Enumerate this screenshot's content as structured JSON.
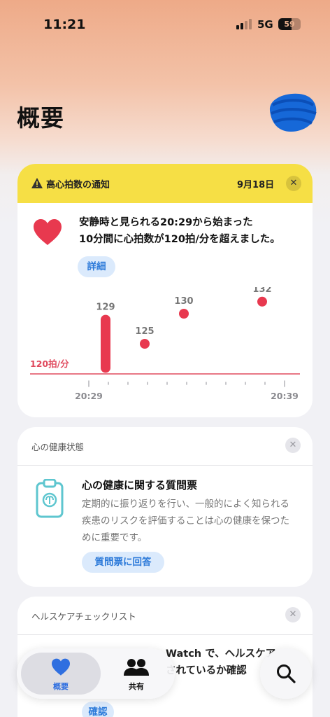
{
  "status_bar": {
    "time": "11:21",
    "network": "5G",
    "battery": "59"
  },
  "page": {
    "title": "概要"
  },
  "heart_alert": {
    "title": "高心拍数の通知",
    "date": "9月18日",
    "message_line1": "安静時と見られる20:29から始まった",
    "message_line2": "10分間に心拍数が120拍/分を超えました。",
    "details_label": "詳細",
    "threshold_label": "120拍/分",
    "start_label": "20:29",
    "end_label": "20:39",
    "readings": [
      {
        "label": "129",
        "min": 121,
        "max": 129
      },
      {
        "label": "125",
        "min": 125,
        "max": 125
      },
      {
        "label": "130",
        "min": 130,
        "max": 130
      },
      {
        "label": "132",
        "min": 132,
        "max": 132
      }
    ],
    "colors": {
      "header": "#f6df45",
      "heart": "#e8394f",
      "threshold": "#e04a5e"
    }
  },
  "mental_health": {
    "section": "心の健康状態",
    "title": "心の健康に関する質問票",
    "body": "定期的に振り返りを行い、一般的によく知られる疾患のリスクを評価することは心の健康を保つために重要です。",
    "button": "質問票に回答"
  },
  "checklist": {
    "section": "ヘルスケアチェックリスト",
    "line1": "Watch で、ヘルスケア",
    "line2": "されているか確認",
    "button": "確認"
  },
  "tabs": {
    "summary": "概要",
    "sharing": "共有"
  },
  "icons": {
    "avatar": "avatar-scribble",
    "search": "search-icon",
    "close": "close-icon"
  }
}
